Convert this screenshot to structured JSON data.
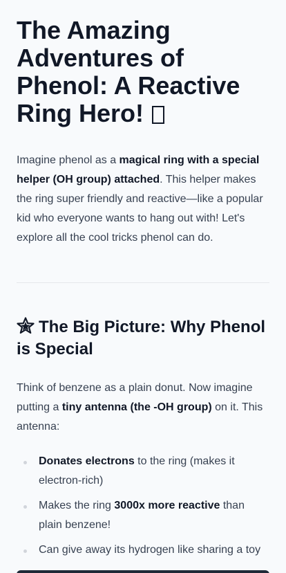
{
  "title": "The Amazing Adventures of Phenol: A Reactive Ring Hero!",
  "title_emoji_icon": "missing-glyph-icon",
  "intro": {
    "before": "Imagine phenol as a ",
    "bold": "magical ring with a special helper (OH group) attached",
    "after": ". This helper makes the ring super friendly and reactive—like a popular kid who everyone wants to hang out with! Let's explore all the cool tricks phenol can do."
  },
  "section": {
    "icon": "star-icon",
    "heading": "The Big Picture: Why Phenol is Special",
    "paragraph": {
      "before": "Think of benzene as a plain donut. Now imagine putting a ",
      "bold": "tiny antenna (the -OH group)",
      "after": " on it. This antenna:"
    },
    "bullets": [
      {
        "bold": "Donates electrons",
        "after": " to the ring (makes it electron-rich)"
      },
      {
        "before": "Makes the ring ",
        "bold": "3000x more reactive",
        "after": " than plain benzene!"
      },
      {
        "text": "Can give away its hydrogen like sharing a toy"
      }
    ]
  }
}
